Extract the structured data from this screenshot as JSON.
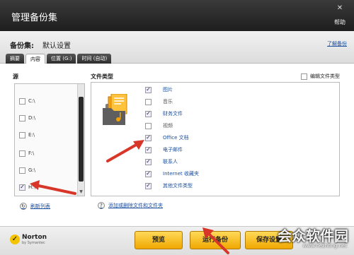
{
  "window": {
    "title": "管理备份集",
    "close_glyph": "✕",
    "help_label": "帮助"
  },
  "header": {
    "backup_set_label": "备份集:",
    "backup_set_name": "默认设置",
    "learn_link": "了解备份"
  },
  "tabs": [
    {
      "label": "摘要",
      "active": false
    },
    {
      "label": "内容",
      "active": true
    },
    {
      "label": "位置 (G:)",
      "active": false
    },
    {
      "label": "时间 (自动)",
      "active": false
    }
  ],
  "left_panel": {
    "title": "源",
    "drives": [
      {
        "label": "C:\\",
        "checked": false
      },
      {
        "label": "D:\\",
        "checked": false
      },
      {
        "label": "E:\\",
        "checked": false
      },
      {
        "label": "F:\\",
        "checked": false
      },
      {
        "label": "G:\\",
        "checked": false
      },
      {
        "label": "H:\\",
        "checked": true
      }
    ],
    "refresh_label": "刷新列表"
  },
  "right_panel": {
    "title": "文件类型",
    "edit_types_label": "编辑文件类型",
    "file_types": [
      {
        "label": "图片",
        "checked": true
      },
      {
        "label": "音乐",
        "checked": false
      },
      {
        "label": "财务文件",
        "checked": true
      },
      {
        "label": "视频",
        "checked": false
      },
      {
        "label": "Office 文档",
        "checked": true
      },
      {
        "label": "电子邮件",
        "checked": true
      },
      {
        "label": "联系人",
        "checked": true
      },
      {
        "label": "Internet 收藏夹",
        "checked": true
      },
      {
        "label": "其他文件类型",
        "checked": true
      }
    ],
    "add_remove_label": "添加或删除文件和文件夹"
  },
  "footer": {
    "brand": "Norton",
    "brand_sub": "by Symantec",
    "preview_label": "预览",
    "run_backup_label": "运行备份",
    "save_label": "保存设置"
  },
  "watermark": {
    "text": "会众软件园",
    "url": "www.hezhong.net"
  },
  "colors": {
    "title_bar": "#2a2a2a",
    "accent_button": "#f5b800",
    "link": "#1a4fa0",
    "arrow": "#d9362a"
  }
}
